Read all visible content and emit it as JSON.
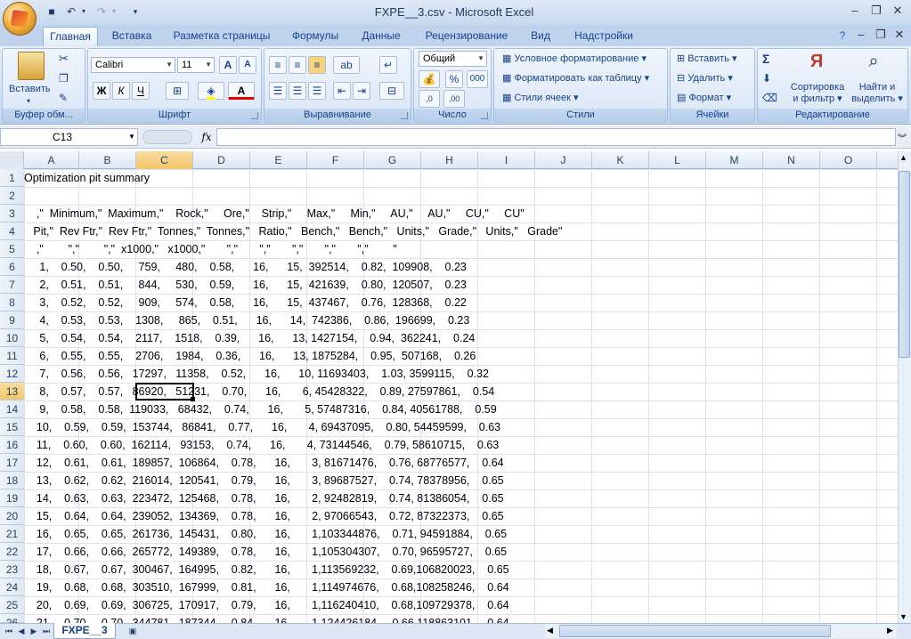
{
  "window": {
    "title": "FXPE__3.csv - Microsoft Excel",
    "minimize": "–",
    "restore": "❐",
    "close": "✕"
  },
  "tabs": [
    "Главная",
    "Вставка",
    "Разметка страницы",
    "Формулы",
    "Данные",
    "Рецензирование",
    "Вид",
    "Надстройки"
  ],
  "ribbon": {
    "clipboard": {
      "label": "Буфер обм...",
      "paste": "Вставить"
    },
    "font": {
      "label": "Шрифт",
      "name": "Calibri",
      "size": "11",
      "bold": "Ж",
      "italic": "К",
      "underline": "Ч",
      "grow": "A",
      "shrink": "A",
      "fontcolor": "A"
    },
    "alignment": {
      "label": "Выравнивание"
    },
    "number": {
      "label": "Число",
      "format": "Общий",
      "percent": "%",
      "thousands": "000",
      "inc": ",0",
      "dec": ",00"
    },
    "styles": {
      "label": "Стили",
      "conditional": "Условное форматирование",
      "table": "Форматировать как таблицу",
      "cell": "Стили ячеек"
    },
    "cells": {
      "label": "Ячейки",
      "insert": "Вставить",
      "delete": "Удалить",
      "format": "Формат"
    },
    "editing": {
      "label": "Редактирование",
      "sum": "Σ",
      "sort1": "Сортировка",
      "sort2": "и фильтр",
      "find1": "Найти и",
      "find2": "выделить"
    }
  },
  "formula_bar": {
    "name_box": "C13",
    "fx": "fx",
    "value": ""
  },
  "columns": [
    "A",
    "B",
    "C",
    "D",
    "E",
    "F",
    "G",
    "H",
    "I",
    "J",
    "K",
    "L",
    "M",
    "N",
    "O"
  ],
  "selected_column": "C",
  "rows": [
    {
      "n": "1",
      "text": "Optimization pit summary"
    },
    {
      "n": "2",
      "text": ""
    },
    {
      "n": "3",
      "text": "    ,\"  Minimum,\"  Maximum,\"    Rock,\"     Ore,\"    Strip,\"     Max,\"     Min,\"     AU,\"     AU,\"     CU,\"     CU\""
    },
    {
      "n": "4",
      "text": "   Pit,\"  Rev Ftr,\"  Rev Ftr,\"  Tonnes,\"  Tonnes,\"   Ratio,\"   Bench,\"   Bench,\"   Units,\"   Grade,\"   Units,\"   Grade\""
    },
    {
      "n": "5",
      "text": "    ,\"        \",\"        \",\"  x1000,\"   x1000,\"       \",\"       \",\"       \",\"       \",\"       \",\"        \""
    },
    {
      "n": "6",
      "text": "     1,    0.50,    0.50,     759,     480,    0.58,      16,      15,  392514,    0.82,  109908,    0.23"
    },
    {
      "n": "7",
      "text": "     2,    0.51,    0.51,     844,     530,    0.59,      16,      15,  421639,    0.80,  120507,    0.23"
    },
    {
      "n": "8",
      "text": "     3,    0.52,    0.52,     909,     574,    0.58,      16,      15,  437467,    0.76,  128368,    0.22"
    },
    {
      "n": "9",
      "text": "     4,    0.53,    0.53,    1308,     865,    0.51,      16,      14,  742386,    0.86,  196699,    0.23"
    },
    {
      "n": "10",
      "text": "     5,    0.54,    0.54,    2117,    1518,    0.39,      16,      13, 1427154,    0.94,  362241,    0.24"
    },
    {
      "n": "11",
      "text": "     6,    0.55,    0.55,    2706,    1984,    0.36,      16,      13, 1875284,    0.95,  507168,    0.26"
    },
    {
      "n": "12",
      "text": "     7,    0.56,    0.56,   17297,   11358,    0.52,      16,      10, 11693403,    1.03, 3599115,    0.32"
    },
    {
      "n": "13",
      "text": "     8,    0.57,    0.57,   86920,   51231,    0.70,      16,       6, 45428322,    0.89, 27597861,    0.54"
    },
    {
      "n": "14",
      "text": "     9,    0.58,    0.58,  119033,   68432,    0.74,      16,       5, 57487316,    0.84, 40561788,    0.59"
    },
    {
      "n": "15",
      "text": "    10,    0.59,    0.59,  153744,   86841,    0.77,      16,       4, 69437095,    0.80, 54459599,    0.63"
    },
    {
      "n": "16",
      "text": "    11,    0.60,    0.60,  162114,   93153,    0.74,      16,       4, 73144546,    0.79, 58610715,    0.63"
    },
    {
      "n": "17",
      "text": "    12,    0.61,    0.61,  189857,  106864,    0.78,      16,       3, 81671476,    0.76, 68776577,    0.64"
    },
    {
      "n": "18",
      "text": "    13,    0.62,    0.62,  216014,  120541,    0.79,      16,       3, 89687527,    0.74, 78378956,    0.65"
    },
    {
      "n": "19",
      "text": "    14,    0.63,    0.63,  223472,  125468,    0.78,      16,       2, 92482819,    0.74, 81386054,    0.65"
    },
    {
      "n": "20",
      "text": "    15,    0.64,    0.64,  239052,  134369,    0.78,      16,       2, 97066543,    0.72, 87322373,    0.65"
    },
    {
      "n": "21",
      "text": "    16,    0.65,    0.65,  261736,  145431,    0.80,      16,       1,103344876,    0.71, 94591884,    0.65"
    },
    {
      "n": "22",
      "text": "    17,    0.66,    0.66,  265772,  149389,    0.78,      16,       1,105304307,    0.70, 96595727,    0.65"
    },
    {
      "n": "23",
      "text": "    18,    0.67,    0.67,  300467,  164995,    0.82,      16,       1,113569232,    0.69,106820023,    0.65"
    },
    {
      "n": "24",
      "text": "    19,    0.68,    0.68,  303510,  167999,    0.81,      16,       1,114974676,    0.68,108258246,    0.64"
    },
    {
      "n": "25",
      "text": "    20,    0.69,    0.69,  306725,  170917,    0.79,      16,       1,116240410,    0.68,109729378,    0.64"
    },
    {
      "n": "26",
      "text": "    21,    0.70,    0.70,  344781,  187344,    0.84,      16,       1,124426184,    0.66,118863101,    0.64"
    }
  ],
  "selected_row": "13",
  "sheet_tab": "FXPE__3"
}
